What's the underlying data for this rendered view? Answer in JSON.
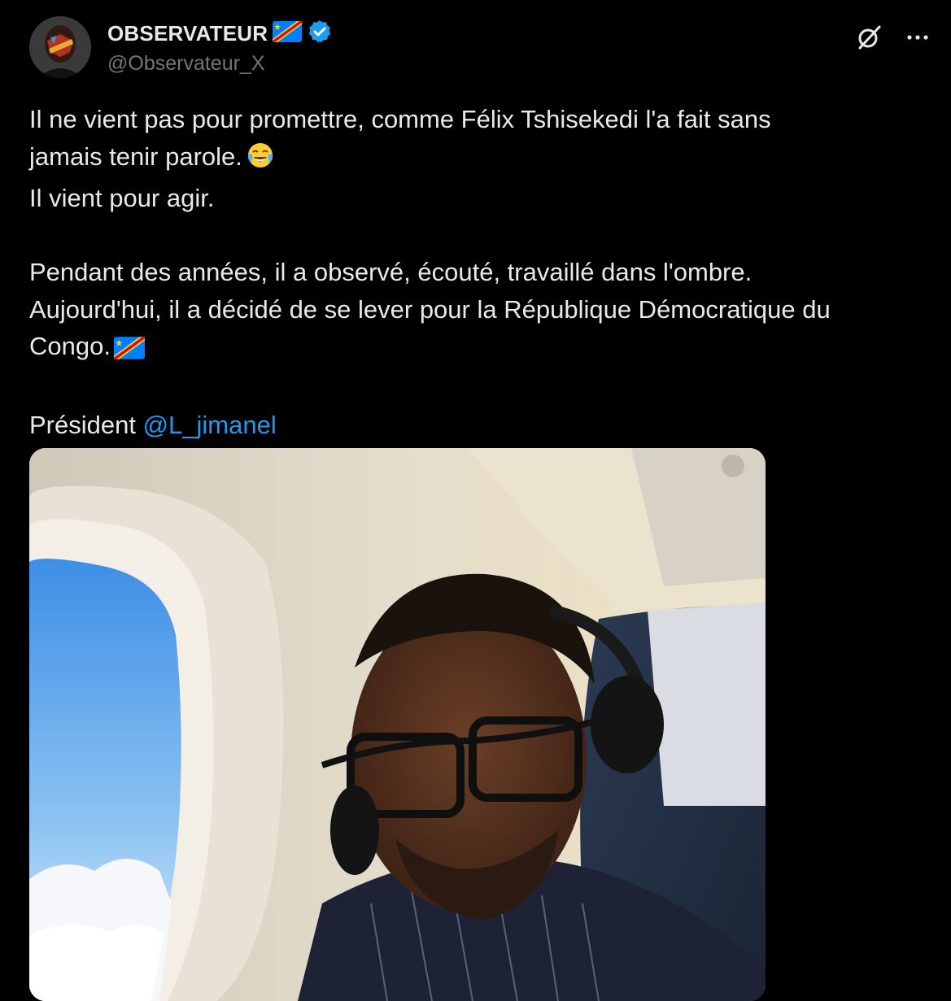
{
  "author": {
    "display_name": "OBSERVATEUR",
    "handle": "@Observateur_X",
    "verified": true,
    "flag_icon": "drc-flag-icon",
    "verified_color": "#1d9bf0"
  },
  "tweet": {
    "line1": "Il ne vient pas pour promettre, comme Félix Tshisekedi l'a fait sans",
    "line2": "jamais tenir parole.",
    "line2_emoji": "face-with-tears-of-joy-icon",
    "line3": "Il vient pour agir.",
    "line4": "Pendant des années, il a observé, écouté, travaillé dans l'ombre.",
    "line5": "Aujourd'hui, il a décidé de se lever pour la République Démocratique du",
    "line6": "Congo.",
    "line6_emoji": "drc-flag-icon",
    "line7_prefix": "Président ",
    "mention": "@L_jimanel"
  },
  "actions": {
    "grok_icon": "grok-icon",
    "more_icon": "more-icon"
  },
  "colors": {
    "background": "#000000",
    "text": "#e7e9ea",
    "secondary": "#71767b",
    "accent": "#1d9bf0"
  }
}
